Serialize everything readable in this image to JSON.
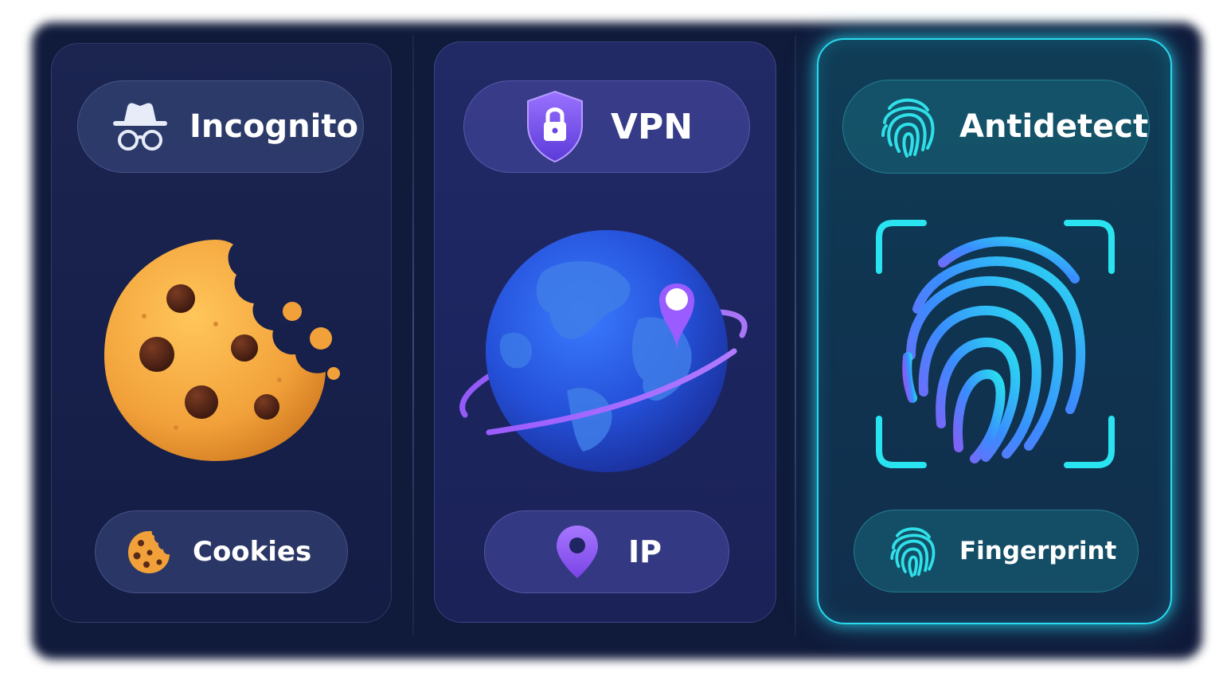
{
  "panels": [
    {
      "title": "Incognito",
      "title_icon": "incognito-icon",
      "hero": "cookie-icon",
      "bottom_label": "Cookies",
      "bottom_icon": "cookie-icon",
      "accent": "#f2a43a"
    },
    {
      "title": "VPN",
      "title_icon": "shield-lock-icon",
      "hero": "globe-location-icon",
      "bottom_label": "IP",
      "bottom_icon": "location-pin-icon",
      "accent": "#8a5cf6"
    },
    {
      "title": "Antidetect",
      "title_icon": "fingerprint-icon",
      "hero": "fingerprint-scan-icon",
      "bottom_label": "Fingerprint",
      "bottom_icon": "fingerprint-icon",
      "accent": "#29d9ee",
      "highlighted": true
    }
  ]
}
